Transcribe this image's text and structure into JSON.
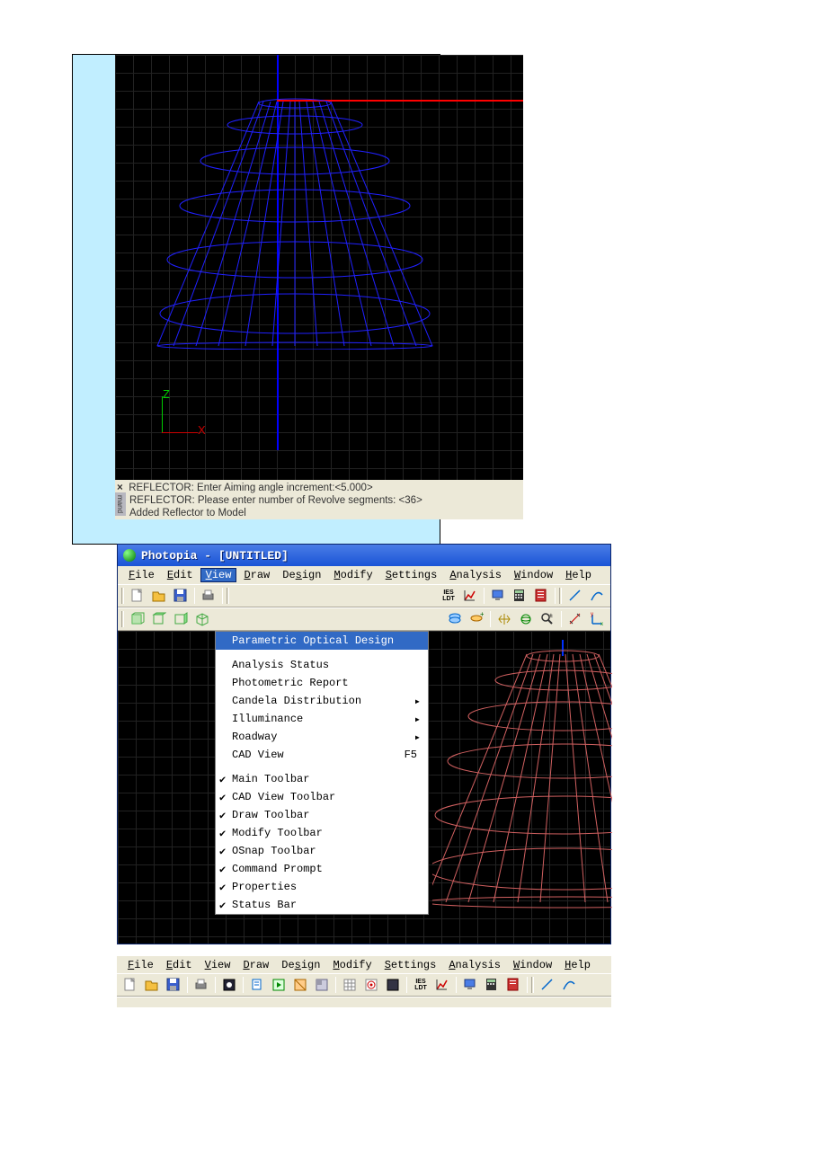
{
  "frame1": {
    "axis_z": "Z",
    "axis_x": "X",
    "cmd1": "REFLECTOR: Enter Aiming angle increment:<5.000>",
    "cmd2": "REFLECTOR: Please enter number of Revolve segments: <36>",
    "cmd3": "Added Reflector to Model",
    "close": "×",
    "tab": "mand"
  },
  "win2": {
    "title": "Photopia - [UNTITLED]",
    "menus": [
      "File",
      "Edit",
      "View",
      "Draw",
      "Design",
      "Modify",
      "Settings",
      "Analysis",
      "Window",
      "Help"
    ],
    "menu_accel": [
      "F",
      "E",
      "V",
      "D",
      "s",
      "M",
      "S",
      "A",
      "W",
      "H"
    ],
    "open_idx": 2,
    "dropdown": {
      "section1": [
        {
          "label": "Parametric Optical Design",
          "u": "P",
          "hl": true
        },
        {
          "label": "Analysis Status",
          "u": "A"
        },
        {
          "label": "Photometric Report",
          "u": "P"
        },
        {
          "label": "Candela Distribution",
          "u": "C",
          "sub": true
        },
        {
          "label": "Illuminance",
          "u": "I",
          "sub": true
        },
        {
          "label": "Roadway",
          "u": "R",
          "sub": true
        },
        {
          "label": "CAD View",
          "u": "D",
          "shortcut": "F5"
        }
      ],
      "section2": [
        {
          "label": "Main Toolbar",
          "u": "M",
          "chk": true
        },
        {
          "label": "CAD View Toolbar",
          "u": "V",
          "chk": true
        },
        {
          "label": "Draw Toolbar",
          "u": "r",
          "chk": true
        },
        {
          "label": "Modify Toolbar",
          "u": "T",
          "chk": true
        },
        {
          "label": "OSnap Toolbar",
          "u": "O",
          "chk": true
        },
        {
          "label": "Command Prompt",
          "u": "n",
          "chk": true
        },
        {
          "label": "Properties",
          "u": "P",
          "chk": true
        },
        {
          "label": "Status Bar",
          "u": "S",
          "chk": true
        }
      ]
    },
    "ies": "IES\nLDT"
  }
}
